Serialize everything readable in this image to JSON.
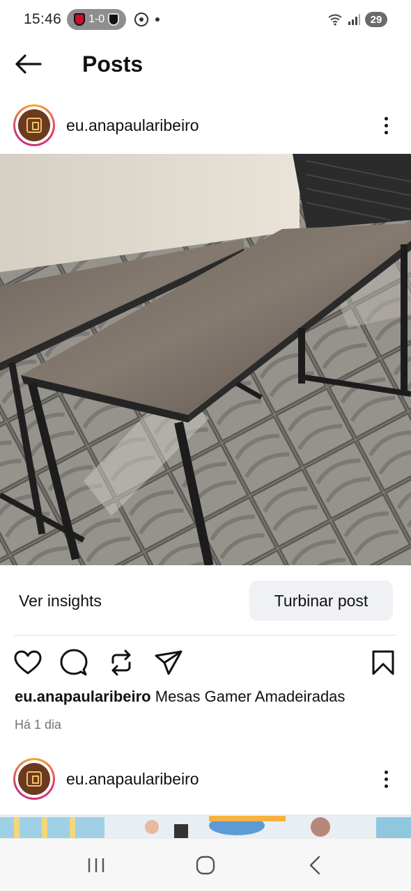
{
  "status_bar": {
    "time": "15:46",
    "score": "1-0",
    "battery": "29"
  },
  "header": {
    "title": "Posts",
    "back_icon": "arrow-left-icon"
  },
  "post": {
    "username": "eu.anapaularibeiro",
    "insights_label": "Ver insights",
    "boost_label": "Turbinar post",
    "caption_user": "eu.anapaularibeiro",
    "caption_text": "Mesas Gamer Amadeiradas",
    "timestamp": "Há 1 dia",
    "actions": [
      "heart-icon",
      "comment-icon",
      "repost-icon",
      "share-icon",
      "bookmark-icon"
    ]
  },
  "next_post": {
    "username": "eu.anapaularibeiro"
  },
  "nav": {
    "items": [
      "recent-apps-icon",
      "home-icon",
      "back-icon"
    ]
  },
  "colors": {
    "text": "#111111",
    "muted": "#737373",
    "boost_bg": "#eff1f5"
  }
}
